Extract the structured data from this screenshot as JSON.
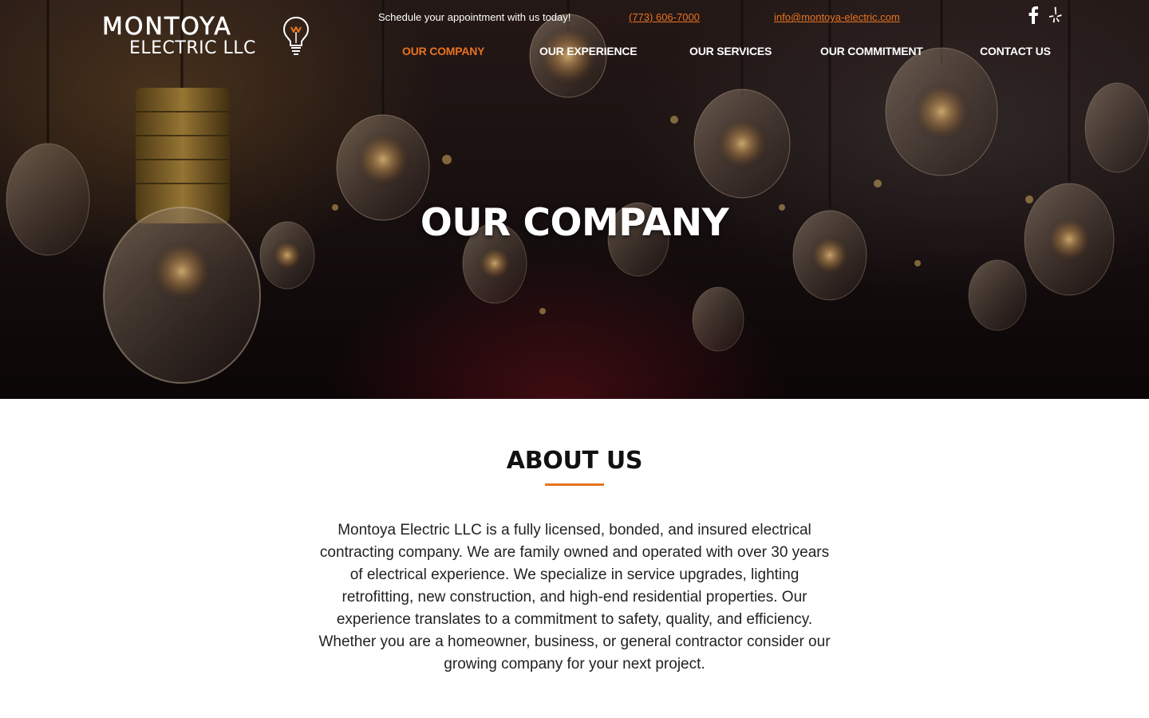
{
  "brand": {
    "name_line1": "MONTOYA",
    "name_line2": "ELECTRIC LLC",
    "logo_icon": "lightbulb-icon",
    "accent_color": "#e8731f"
  },
  "topbar": {
    "tagline": "Schedule your appointment with us today!",
    "phone": "(773) 606-7000",
    "email": "info@montoya-electric.com",
    "social": [
      "facebook-icon",
      "yelp-icon"
    ]
  },
  "nav": {
    "items": [
      {
        "label": "OUR COMPANY",
        "active": true
      },
      {
        "label": "OUR EXPERIENCE",
        "active": false
      },
      {
        "label": "OUR SERVICES",
        "active": false
      },
      {
        "label": "OUR COMMITMENT",
        "active": false
      },
      {
        "label": "CONTACT US",
        "active": false
      }
    ]
  },
  "hero": {
    "title": "OUR COMPANY"
  },
  "about": {
    "heading": "ABOUT US",
    "body": "Montoya Electric LLC is a fully licensed, bonded, and insured electrical contracting company. We are family owned and operated with over 30 years of electrical experience. We specialize in service upgrades, lighting retrofitting, new construction, and high-end residential properties. Our experience translates to a commitment to safety, quality, and efficiency. Whether you are a homeowner, business, or general contractor consider our growing company for your next project."
  }
}
